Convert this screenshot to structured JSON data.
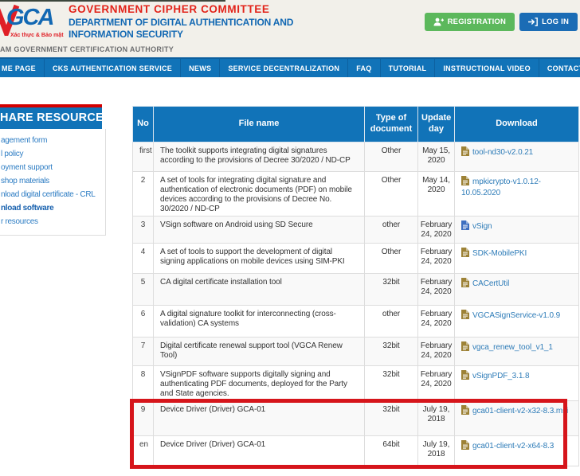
{
  "colors": {
    "primary_blue": "#1173b8",
    "link_blue": "#2e7cb8",
    "annotation_red": "#d6151b",
    "button_green": "#5cb85c",
    "button_login_blue": "#1b6cb5",
    "row_stripe": "#f9f9f9",
    "file_icon_tan": "#9d8236",
    "file_icon_blue": "#3d6fc0",
    "brand_red": "#e2231a",
    "brand_blue": "#1268b3"
  },
  "header": {
    "logo": {
      "text": "GCA",
      "tagline": "Xác thực & Bảo mật"
    },
    "committee": "GOVERNMENT CIPHER COMMITTEE",
    "department_line1": "DEPARTMENT OF DIGITAL AUTHENTICATION AND",
    "department_line2": "INFORMATION SECURITY",
    "authority": "AM GOVERNMENT CERTIFICATION AUTHORITY",
    "buttons": {
      "registration": "REGISTRATION",
      "login": "LOG IN"
    }
  },
  "nav": {
    "items": [
      "ME PAGE",
      "CKS AUTHENTICATION SERVICE",
      "NEWS",
      "SERVICE DECENTRALIZATION",
      "FAQ",
      "TUTORIAL",
      "INSTRUCTIONAL VIDEO",
      "CONTACT"
    ]
  },
  "sidebar": {
    "title": "HARE RESOURCES",
    "items": [
      {
        "label": "agement form",
        "bold": false
      },
      {
        "label": "l policy",
        "bold": false
      },
      {
        "label": "oyment support",
        "bold": false
      },
      {
        "label": "shop materials",
        "bold": false
      },
      {
        "label": "nload digital certificate - CRL",
        "bold": false
      },
      {
        "label": "nload software",
        "bold": true
      },
      {
        "label": "r resources",
        "bold": false
      }
    ]
  },
  "table": {
    "headers": [
      "No",
      "File name",
      "Type of document",
      "Update day",
      "Download"
    ],
    "rows": [
      {
        "no": "first",
        "name": "The toolkit supports integrating digital signatures according to the provisions of Decree 30/2020 / ND-CP",
        "type": "Other",
        "date": "May 15, 2020",
        "download": "tool-nd30-v2.0.21",
        "icon_color": "#9d8236",
        "nowrap": false
      },
      {
        "no": "2",
        "name": "A set of tools for integrating digital signature and authentication of electronic documents (PDF) on mobile devices according to the provisions of Decree No. 30/2020 / ND-CP",
        "type": "Other",
        "date": "May 14, 2020",
        "download": "mpkicrypto-v1.0.12-10.05.2020",
        "icon_color": "#9d8236",
        "nowrap": false
      },
      {
        "no": "3",
        "name": "VSign software on Android using SD Secure",
        "type": "other",
        "date": "February 24, 2020",
        "download": "vSign",
        "icon_color": "#3d6fc0",
        "nowrap": false
      },
      {
        "no": "4",
        "name": "A set of tools to support the development of digital signing applications on mobile devices using SIM-PKI",
        "type": "Other",
        "date": "February 24, 2020",
        "download": "SDK-MobilePKI",
        "icon_color": "#9d8236",
        "nowrap": false
      },
      {
        "no": "5",
        "name": "CA digital certificate installation tool",
        "type": "32bit",
        "date": "February 24, 2020",
        "download": "CACertUtil",
        "icon_color": "#9d8236",
        "nowrap": false
      },
      {
        "no": "6",
        "name": "A digital signature toolkit for interconnecting (cross-validation) CA systems",
        "type": "other",
        "date": "February 24, 2020",
        "download": "VGCASignService-v1.0.9",
        "icon_color": "#9d8236",
        "nowrap": false
      },
      {
        "no": "7",
        "name": "Digital certificate renewal support tool (VGCA Renew Tool)",
        "type": "32bit",
        "date": "February 24, 2020",
        "download": "vgca_renew_tool_v1_1",
        "icon_color": "#9d8236",
        "nowrap": false
      },
      {
        "no": "8",
        "name": "VSignPDF software supports digitally signing and authenticating PDF documents, deployed for the Party and State agencies.",
        "type": "32bit",
        "date": "February 24, 2020",
        "download": "vSignPDF_3.1.8",
        "icon_color": "#9d8236",
        "nowrap": false
      },
      {
        "no": "9",
        "name": "Device Driver (Driver) GCA-01",
        "type": "32bit",
        "date": "July 19, 2018",
        "download": "gca01-client-v2-x32-8.3.msi",
        "icon_color": "#9d8236",
        "nowrap": false
      },
      {
        "no": "en",
        "name": "Device Driver (Driver) GCA-01",
        "type": "64bit",
        "date": "July 19, 2018",
        "download": "gca01-client-v2-x64-8.3",
        "icon_color": "#9d8236",
        "nowrap": true
      }
    ]
  },
  "annotation": {
    "highlighted_rows": [
      9,
      10
    ],
    "color": "#d6151b"
  }
}
